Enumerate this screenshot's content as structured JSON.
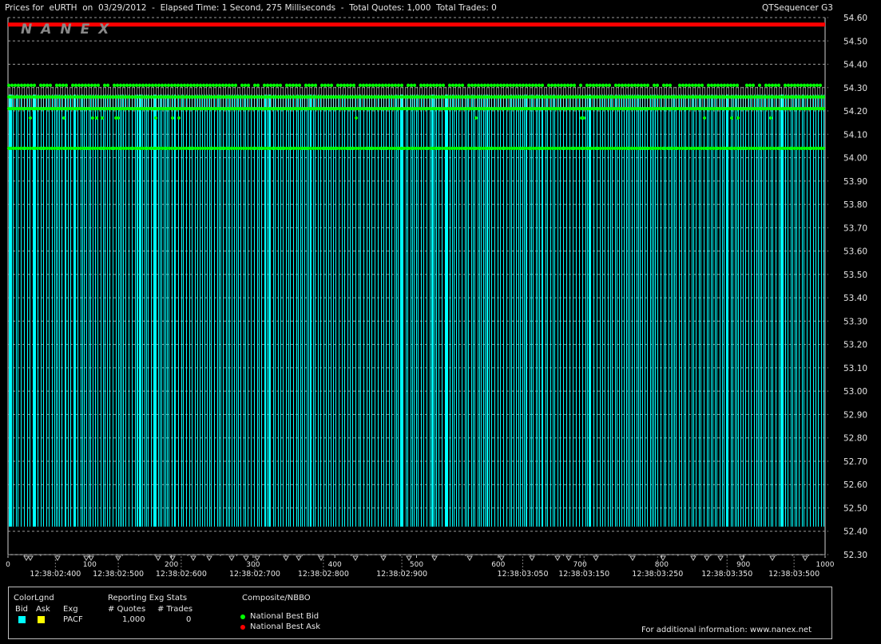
{
  "header": {
    "title": "Prices for  eURTH  on  03/29/2012  -  Elapsed Time: 1 Second, 275 Milliseconds  -  Total Quotes: 1,000  Total Trades: 0",
    "app_name": "QTSequencer G3",
    "watermark": "NANEX"
  },
  "chart_data": {
    "type": "line",
    "ylim": [
      52.3,
      54.6
    ],
    "y_ticks": [
      "54.60",
      "54.50",
      "54.40",
      "54.30",
      "54.20",
      "54.10",
      "54.00",
      "53.90",
      "53.80",
      "53.70",
      "53.60",
      "53.50",
      "53.40",
      "53.30",
      "53.20",
      "53.10",
      "53.00",
      "52.90",
      "52.80",
      "52.70",
      "52.60",
      "52.50",
      "52.40",
      "52.30"
    ],
    "xlim": [
      0,
      1000
    ],
    "x_ticks": [
      "0",
      "100",
      "200",
      "300",
      "400",
      "500",
      "600",
      "700",
      "800",
      "900",
      "1000"
    ],
    "time_labels": [
      {
        "x": 58,
        "label": "12:38:02:400"
      },
      {
        "x": 135,
        "label": "12:38:02:500"
      },
      {
        "x": 212,
        "label": "12:38:02:600"
      },
      {
        "x": 302,
        "label": "12:38:02:700"
      },
      {
        "x": 386,
        "label": "12:38:02:800"
      },
      {
        "x": 482,
        "label": "12:38:02:900"
      },
      {
        "x": 630,
        "label": "12:38:03:050"
      },
      {
        "x": 705,
        "label": "12:38:03:150"
      },
      {
        "x": 795,
        "label": "12:38:03:250"
      },
      {
        "x": 880,
        "label": "12:38:03:350"
      },
      {
        "x": 962,
        "label": "12:38:03:500"
      }
    ],
    "series": [
      {
        "name": "National Best Ask",
        "color": "#ff0000",
        "values": [
          54.57
        ]
      },
      {
        "name": "National Best Bid",
        "color": "#00ff00",
        "levels": [
          54.31,
          54.26,
          54.21,
          54.04
        ],
        "occasional": 54.17
      },
      {
        "name": "PACF Bid",
        "color": "#00ffff",
        "low": 52.42
      }
    ],
    "colors": {
      "bid": "#00ffff",
      "ask": "#ffff00",
      "nbb": "#00ff00",
      "nbo": "#ff0000",
      "grid": "#bdbdbd"
    }
  },
  "legend": {
    "color_legend": {
      "title": "ColorLgnd",
      "bid_label": "Bid",
      "ask_label": "Ask"
    },
    "exchange_stats": {
      "title": "Reporting Exg Stats",
      "col_exchange": "Exg",
      "col_quotes": "# Quotes",
      "col_trades": "# Trades",
      "row": {
        "exchange": "PACF",
        "quotes": "1,000",
        "trades": "0"
      }
    },
    "composite": {
      "title": "Composite/NBBO",
      "nbb_label": "National Best Bid",
      "nbo_label": "National Best Ask"
    },
    "footer_info": "For additional information: www.nanex.net"
  }
}
